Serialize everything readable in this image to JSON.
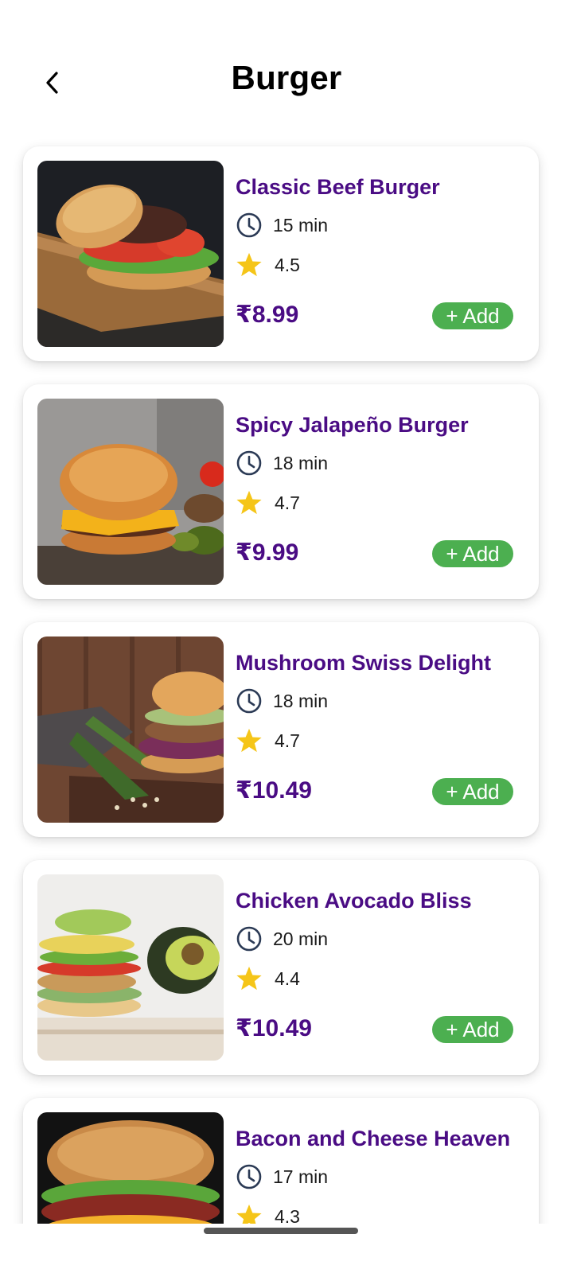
{
  "header": {
    "title": "Burger",
    "back_icon": "chevron-left-icon"
  },
  "colors": {
    "accent_purple": "#4a0c84",
    "add_green": "#4caf50",
    "star_yellow": "#f5c518",
    "clock_stroke": "#2b3a55"
  },
  "items": [
    {
      "name": "Classic Beef Burger",
      "time": "15 min",
      "rating": "4.5",
      "price": "₹8.99",
      "add_label": "+ Add"
    },
    {
      "name": "Spicy Jalapeño Burger",
      "time": "18 min",
      "rating": "4.7",
      "price": "₹9.99",
      "add_label": "+ Add"
    },
    {
      "name": "Mushroom Swiss Delight",
      "time": "18 min",
      "rating": "4.7",
      "price": "₹10.49",
      "add_label": "+ Add"
    },
    {
      "name": "Chicken Avocado Bliss",
      "time": "20 min",
      "rating": "4.4",
      "price": "₹10.49",
      "add_label": "+ Add"
    },
    {
      "name": "Bacon and Cheese Heaven",
      "time": "17 min",
      "rating": "4.3",
      "price": "",
      "add_label": ""
    }
  ]
}
